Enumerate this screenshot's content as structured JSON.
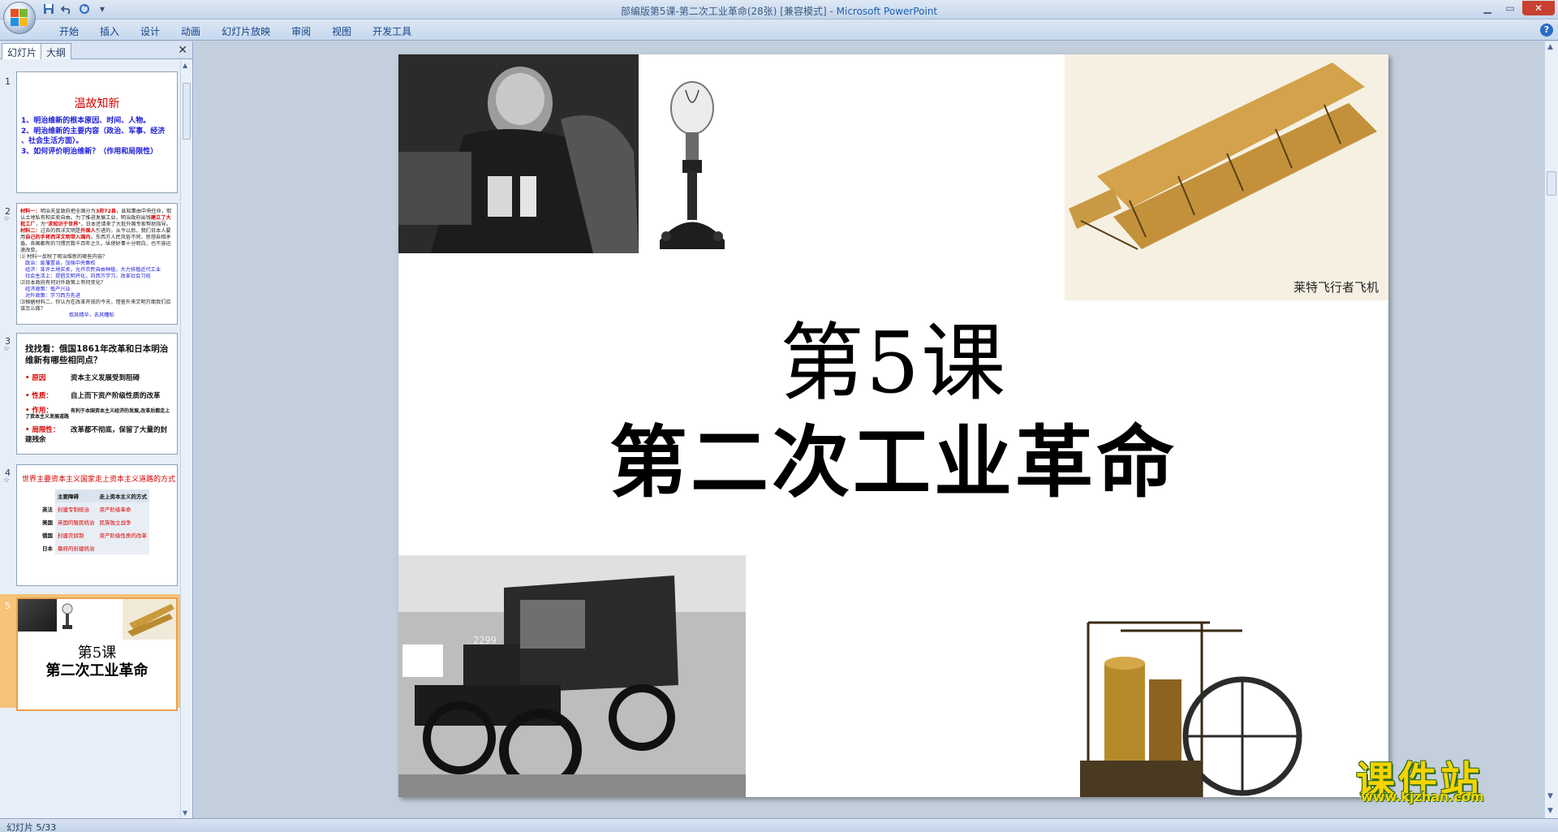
{
  "window": {
    "title": "部编版第5课-第二次工业革命(28张) [兼容模式] - ",
    "app_name": "Microsoft PowerPoint",
    "quick_access": [
      "save-icon",
      "undo-icon",
      "redo-icon",
      "customize-icon"
    ]
  },
  "ribbon": {
    "tabs": [
      "开始",
      "插入",
      "设计",
      "动画",
      "幻灯片放映",
      "审阅",
      "视图",
      "开发工具"
    ]
  },
  "left_panel": {
    "tab_slides": "幻灯片",
    "tab_outline": "大纲",
    "close": "✕",
    "slides": [
      {
        "num": "1",
        "title": "温故知新",
        "lines": [
          "1、明治维新的根本原因、时间、人物。",
          "2、明治维新的主要内容（政治、军事、经济",
          "、社会生活方面）。",
          "3、如何评价明治维新？（作用和局限性）"
        ]
      },
      {
        "num": "2",
        "mat1_label": "材料一：",
        "mat1_a": "明治天皇政府把全国分为",
        "mat1_b": "3府72县",
        "mat1_c": "，县知事由中央任命，取认土地私有和买卖自由。为了推进发展工业，明治政府出钱",
        "mat1_d": "建立了大批工厂",
        "mat1_e": "，为",
        "mat1_f": "\"求知识于世界\"",
        "mat1_g": "，日本还请来了大批外国专家帮助指导。",
        "mat2_label": "材料二：",
        "mat2_a": "过去的西洋文明是",
        "mat2_b": "外国人",
        "mat2_c": "引进的，从今以后，我们日本人要用",
        "mat2_d": "自己的手将西洋文明带入国内",
        "mat2_e": "。东西方人民风俗不同，思想自相矛盾，各国都有的习惯历数千百年之久，纵使好事十分明白，也不容迅速改变。",
        "q1": "⑴ 材料一反映了明治维新的哪些内容？",
        "a1a": "政治：废藩置县，加强中央集权",
        "a1b": "经济：准许土地买卖，允许农民自由种植，大力扶植近代工业",
        "a1c": "社会生活上：提倡文明开化，向西方学习，改革社会习俗",
        "q2": "⑵日本政府有何对外政策上有何变化？",
        "a2a": "经济政策：殖产兴业",
        "a2b": "对外政策：学习西方先进",
        "q3": "⑶根据材料二，你认为在改革开放的今天，借鉴外来文明方面我们应该怎么做？",
        "a3": "取其精华，去其糟粕"
      },
      {
        "num": "3",
        "head": "找找看：俄国1861年改革和日本明治维新有哪些相同点？",
        "rows": [
          {
            "label": "• 原因",
            "text": "资本主义发展受到阻碍"
          },
          {
            "label": "• 性质：",
            "text": "自上而下资产阶级性质的改革"
          },
          {
            "label": "• 作用：",
            "text": "有利于本国资本主义经济的发展,改革后都走上了资本主义发展道路"
          },
          {
            "label": "• 局限性：",
            "text": "改革都不彻底，保留了大量的封建残余"
          }
        ]
      },
      {
        "num": "4",
        "head": "世界主要资本主义国家走上资本主义道路的方式",
        "col1": "主要障碍",
        "col2": "走上资本主义的方式",
        "rows": [
          [
            "英法",
            "封建专制统治",
            "资产阶级革命"
          ],
          [
            "美国",
            "英国的殖民统治",
            "民族独立战争"
          ],
          [
            "俄国",
            "封建农奴制",
            "资产阶级性质的改革"
          ],
          [
            "日本",
            "幕府的封建统治",
            ""
          ]
        ]
      },
      {
        "num": "5",
        "title1": "第5课",
        "title2": "第二次工业革命"
      }
    ]
  },
  "slide": {
    "title_line1": "第5课",
    "title_line2": "第二次工业革命",
    "plane_caption": "莱特飞行者飞机",
    "car_plate": "2299"
  },
  "watermark": {
    "main": "课件站",
    "url": "www.kjzhan.com"
  },
  "status": {
    "slide_counter": "幻灯片 5/33"
  }
}
